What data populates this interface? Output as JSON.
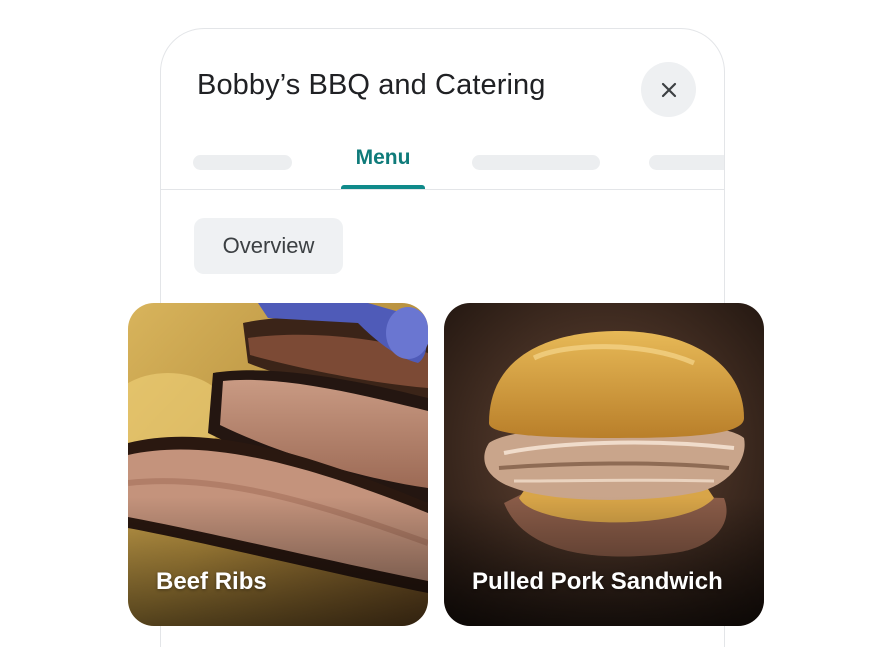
{
  "business": {
    "title": "Bobby’s BBQ and Catering"
  },
  "header": {
    "close_icon": "close-icon"
  },
  "tabs": {
    "active_label": "Menu",
    "accent_color": "#0f8a8a"
  },
  "chips": {
    "overview_label": "Overview"
  },
  "menu_items": [
    {
      "label": "Beef Ribs",
      "image": "sliced-beef-brisket-photo"
    },
    {
      "label": "Pulled Pork Sandwich",
      "image": "pulled-pork-sandwich-photo"
    }
  ]
}
